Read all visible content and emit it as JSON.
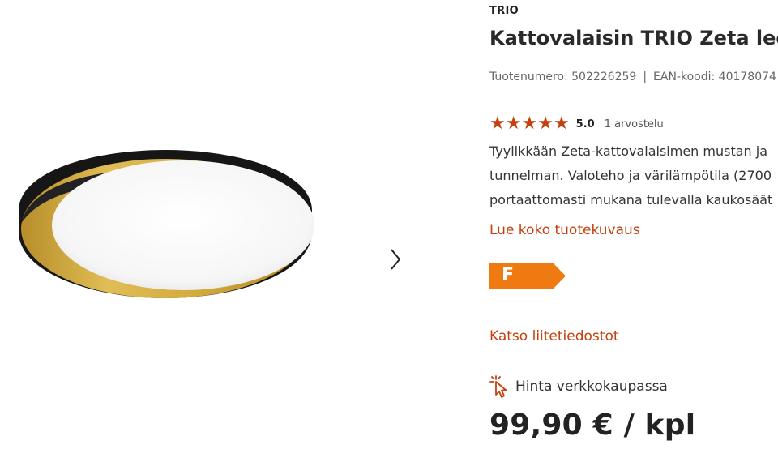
{
  "product": {
    "brand": "TRIO",
    "title": "Kattovalaisin TRIO Zeta led",
    "product_number_label": "Tuotenumero: 502226259",
    "separator": "|",
    "ean_label": "EAN-koodi: 40178074",
    "rating": {
      "stars_value": 5,
      "score": "5.0",
      "count": "1 arvostelu",
      "star_color": "#c4410f"
    },
    "description_lines": [
      "Tyylikkään Zeta-kattovalaisimen mustan ja",
      "tunnelman. Valoteho ja värilämpötila (2700",
      "portaattomasti mukana tulevalla kaukosäät"
    ],
    "read_more": "Lue koko tuotekuvaus",
    "energy_class": "F",
    "energy_color": "#f07a12",
    "attachments": "Katso liitetiedostot",
    "online_price_label": "Hinta verkkokaupassa",
    "price": "99,90 € / kpl",
    "accent_color": "#c4410f"
  },
  "gallery": {
    "image_icon": "ceiling-lamp-image",
    "next_icon": "chevron-right-icon"
  }
}
